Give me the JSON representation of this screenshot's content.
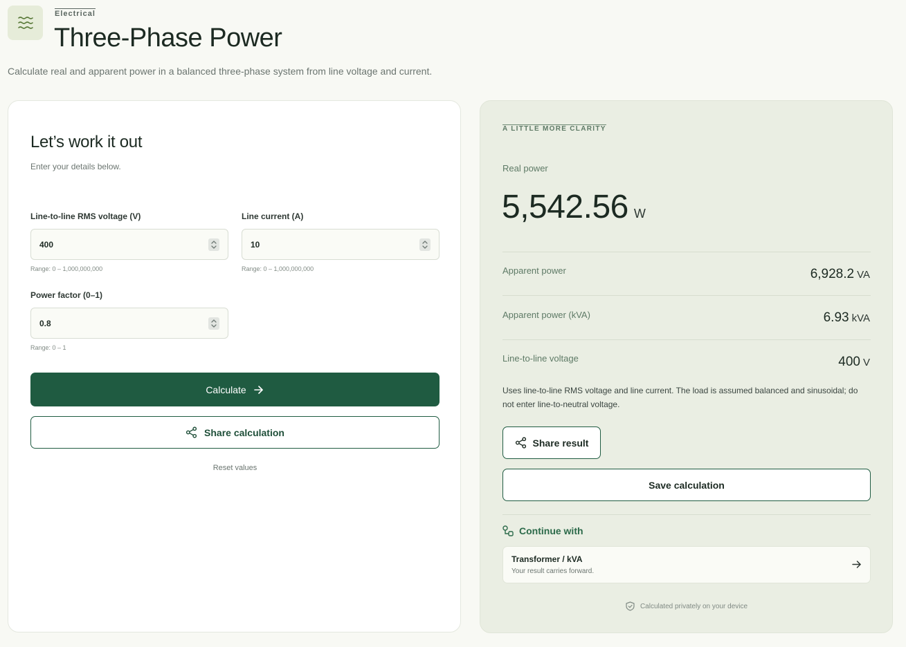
{
  "header": {
    "category": "Electrical",
    "title": "Three-Phase Power",
    "description": "Calculate real and apparent power in a balanced three-phase system from line voltage and current.",
    "icon": "waves-icon"
  },
  "form": {
    "title": "Let’s work it out",
    "subtitle": "Enter your details below.",
    "fields": [
      {
        "label": "Line-to-line RMS voltage (V)",
        "value": "400",
        "range": "Range: 0 – 1,000,000,000"
      },
      {
        "label": "Line current (A)",
        "value": "10",
        "range": "Range: 0 – 1,000,000,000"
      },
      {
        "label": "Power factor (0–1)",
        "value": "0.8",
        "range": "Range: 0 – 1"
      }
    ],
    "calculate_label": "Calculate",
    "share_label": "Share calculation",
    "reset_label": "Reset values"
  },
  "results": {
    "eyebrow": "A LITTLE MORE CLARITY",
    "main_label": "Real power",
    "main_value": "5,542.56",
    "main_unit": "W",
    "rows": [
      {
        "label": "Apparent power",
        "value": "6,928.2",
        "unit": "VA"
      },
      {
        "label": "Apparent power (kVA)",
        "value": "6.93",
        "unit": "kVA"
      },
      {
        "label": "Line-to-line voltage",
        "value": "400",
        "unit": "V"
      }
    ],
    "note": "Uses line-to-line RMS voltage and line current. The load is assumed balanced and sinusoidal; do not enter line-to-neutral voltage.",
    "share_result_label": "Share result",
    "save_label": "Save calculation",
    "continue_heading": "Continue with",
    "continue_item": {
      "title": "Transformer / kVA",
      "subtitle": "Your result carries forward."
    },
    "privacy": "Calculated privately on your device"
  },
  "colors": {
    "accent": "#1f5b41",
    "page_bg": "#f8f9f4",
    "result_bg": "#eaeee3"
  }
}
